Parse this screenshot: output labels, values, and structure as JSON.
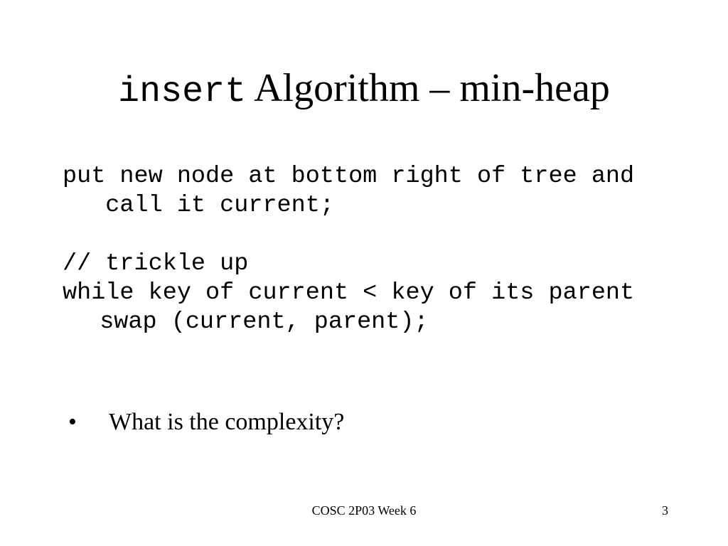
{
  "slide": {
    "title": {
      "code_part": "insert",
      "text_part": " Algorithm – min-heap"
    },
    "code_lines": [
      "put new node at bottom right of tree and",
      "   call it current;",
      "// trickle up",
      "while key of current < key of its parent",
      "  swap (current, parent);"
    ],
    "bullets": [
      {
        "marker": "•",
        "text": "What is the complexity?"
      }
    ],
    "footer": {
      "course": "COSC 2P03 Week 6",
      "page_number": "3"
    }
  }
}
